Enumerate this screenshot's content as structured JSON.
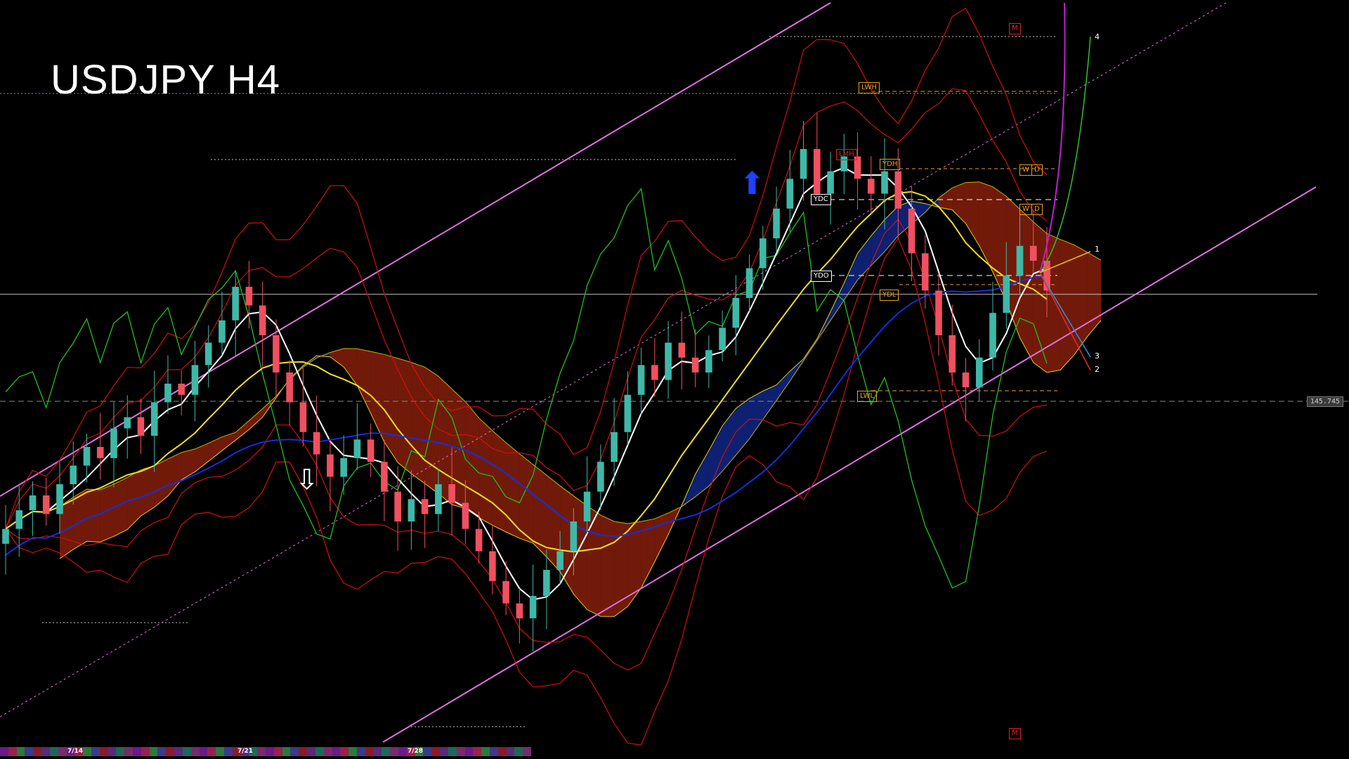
{
  "title": "USDJPY H4",
  "price_tag": "145.745",
  "level_boxes": {
    "ydc": "YDC",
    "ydo": "YDO",
    "ydh": "YDH",
    "ydl": "YDL",
    "lwl": "LWL",
    "lwh": "LWH",
    "lmh": "LMH",
    "w1": "W",
    "d1": "D",
    "w2": "W",
    "d2": "D",
    "m_top": "M",
    "m_bottom": "M"
  },
  "projection_labels": [
    "4",
    "1",
    "3",
    "2"
  ],
  "date_labels": [
    "7/14",
    "7/21",
    "7/28"
  ],
  "colors": {
    "background": "#000000",
    "bull": "#3fb8a8",
    "bear": "#f05060",
    "channel": "#e070e0",
    "ma_white": "#ffffff",
    "ma_yellow": "#f0e020",
    "ma_blue": "#1030e0",
    "bollinger": "#d01010",
    "oscillator": "#20c020",
    "cloud_blue": "#1a3ad0",
    "cloud_red": "#d03010"
  },
  "chart_data": {
    "type": "candlestick",
    "symbol": "USDJPY",
    "timeframe": "H4",
    "closes": [
      145.1,
      145.35,
      145.55,
      145.3,
      145.7,
      145.95,
      146.2,
      146.05,
      146.45,
      146.6,
      146.35,
      146.8,
      147.05,
      146.9,
      147.3,
      147.6,
      147.9,
      148.35,
      148.1,
      147.7,
      147.2,
      146.8,
      146.4,
      146.1,
      145.8,
      146.05,
      146.3,
      146.0,
      145.6,
      145.2,
      145.5,
      145.3,
      145.7,
      145.45,
      145.1,
      144.8,
      144.4,
      144.1,
      143.9,
      144.2,
      144.55,
      144.8,
      145.2,
      145.6,
      146.0,
      146.4,
      146.9,
      147.3,
      147.1,
      147.6,
      147.4,
      147.2,
      147.5,
      147.8,
      148.2,
      148.6,
      149.0,
      149.4,
      149.8,
      150.2,
      149.6,
      149.9,
      150.1,
      149.8,
      149.6,
      149.9,
      149.4,
      148.8,
      148.3,
      147.7,
      147.2,
      147.0,
      147.4,
      148.0,
      148.5,
      148.9,
      148.7,
      148.3
    ],
    "price_levels": {
      "current": 145.745,
      "horizontal_line": 148.25
    },
    "xlabel": "",
    "ylabel": ""
  }
}
